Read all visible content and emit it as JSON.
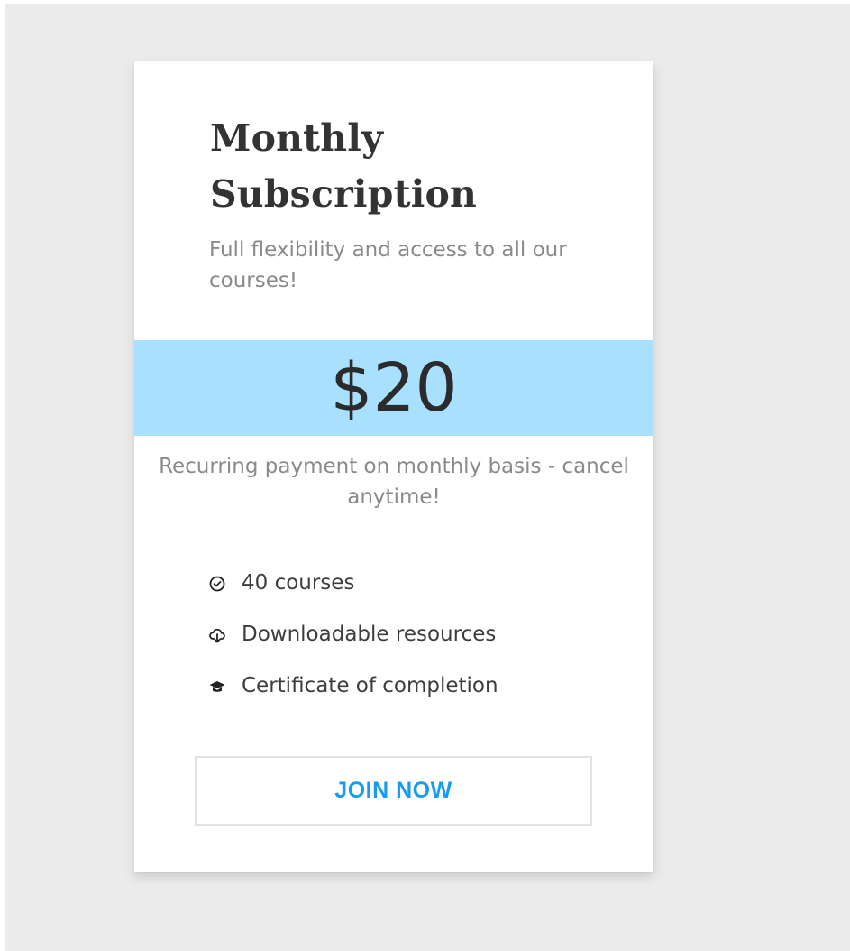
{
  "plan": {
    "title_line1": "Monthly",
    "title_line2": "Subscription",
    "subtitle": "Full flexibility and access to all our courses!",
    "price": "$20",
    "payment_note": "Recurring payment on monthly basis - cancel anytime!",
    "features": [
      {
        "icon": "check-circle-icon",
        "label": "40 courses"
      },
      {
        "icon": "cloud-download-icon",
        "label": "Downloadable resources"
      },
      {
        "icon": "graduation-cap-icon",
        "label": "Certificate of completion"
      }
    ],
    "cta_label": "JOIN NOW"
  },
  "colors": {
    "background": "#ebebeb",
    "card": "#ffffff",
    "price_band": "#a8e0fd",
    "accent": "#1a9cee",
    "title_text": "#333333",
    "muted_text": "#8a8a8a"
  }
}
